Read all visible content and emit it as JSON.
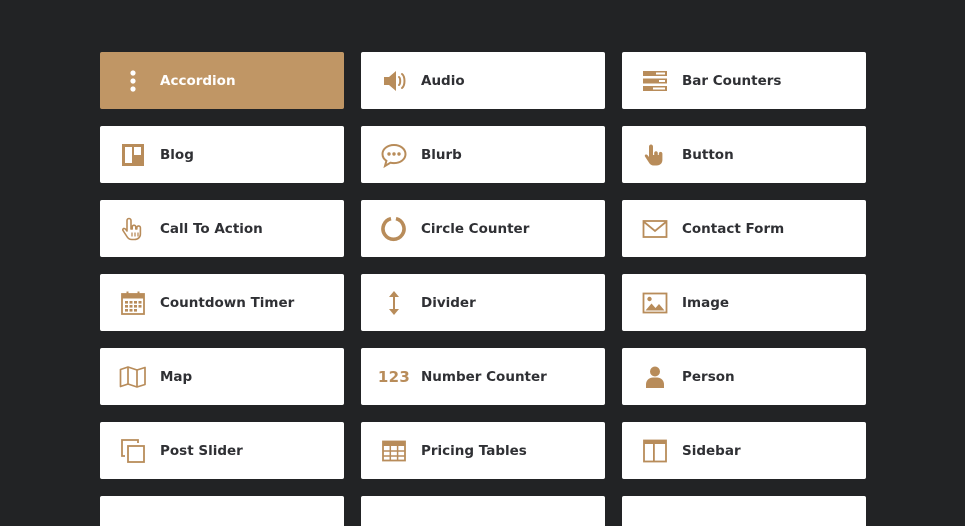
{
  "modules": [
    {
      "label": "Accordion",
      "icon": "vertical-dots-icon",
      "active": true
    },
    {
      "label": "Audio",
      "icon": "speaker-icon"
    },
    {
      "label": "Bar Counters",
      "icon": "bar-counters-icon"
    },
    {
      "label": "Blog",
      "icon": "blog-layout-icon"
    },
    {
      "label": "Blurb",
      "icon": "speech-bubble-icon"
    },
    {
      "label": "Button",
      "icon": "pointer-hand-icon"
    },
    {
      "label": "Call To Action",
      "icon": "hand-cursor-icon"
    },
    {
      "label": "Circle Counter",
      "icon": "circle-counter-icon"
    },
    {
      "label": "Contact Form",
      "icon": "envelope-icon"
    },
    {
      "label": "Countdown Timer",
      "icon": "calendar-icon"
    },
    {
      "label": "Divider",
      "icon": "vertical-arrows-icon"
    },
    {
      "label": "Image",
      "icon": "image-icon"
    },
    {
      "label": "Map",
      "icon": "map-icon"
    },
    {
      "label": "Number Counter",
      "icon": "number-123-icon",
      "icon_text": "123"
    },
    {
      "label": "Person",
      "icon": "person-icon"
    },
    {
      "label": "Post Slider",
      "icon": "stacked-squares-icon"
    },
    {
      "label": "Pricing Tables",
      "icon": "table-grid-icon"
    },
    {
      "label": "Sidebar",
      "icon": "sidebar-layout-icon"
    }
  ],
  "colors": {
    "background": "#222325",
    "accent": "#c09665",
    "icon": "#b88c5a",
    "label": "#2f3034",
    "card": "#ffffff"
  }
}
